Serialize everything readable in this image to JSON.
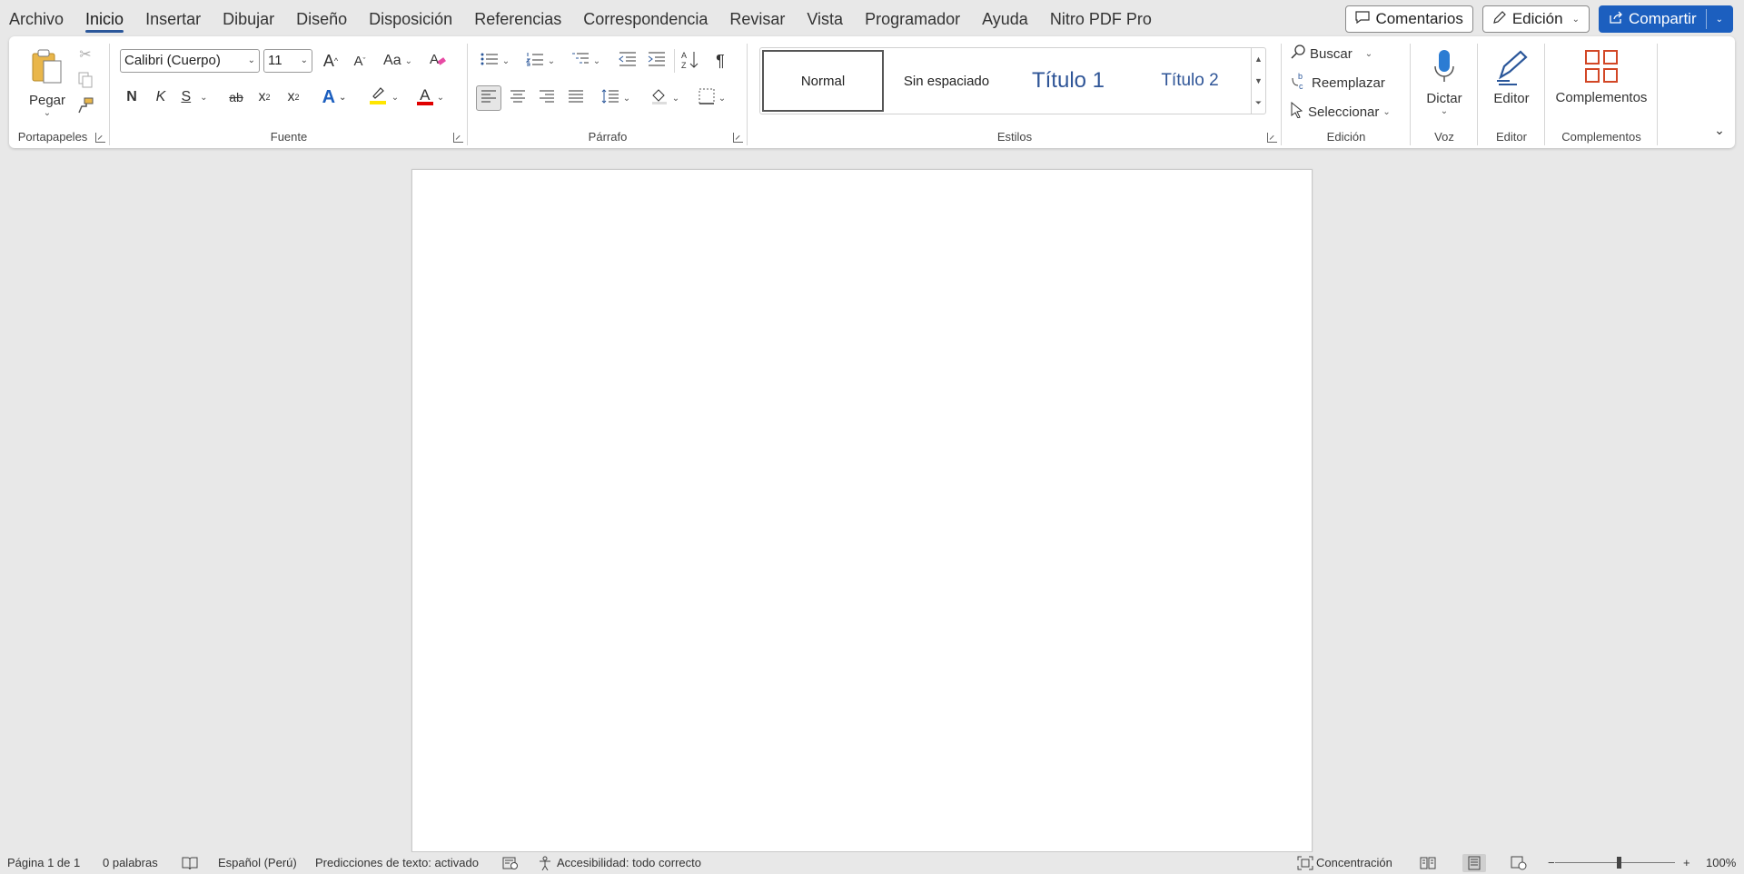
{
  "menu": {
    "tabs": [
      "Archivo",
      "Inicio",
      "Insertar",
      "Dibujar",
      "Diseño",
      "Disposición",
      "Referencias",
      "Correspondencia",
      "Revisar",
      "Vista",
      "Programador",
      "Ayuda",
      "Nitro PDF Pro"
    ],
    "active_tab": "Inicio"
  },
  "top_right": {
    "comments_label": "Comentarios",
    "editing_label": "Edición",
    "share_label": "Compartir"
  },
  "ribbon": {
    "clipboard": {
      "label": "Portapapeles",
      "paste_label": "Pegar"
    },
    "font": {
      "label": "Fuente",
      "font_name": "Calibri (Cuerpo)",
      "font_size": "11",
      "grow_label": "A",
      "shrink_label": "A",
      "case_label": "Aa",
      "bold_label": "N",
      "italic_label": "K",
      "underline_label": "S",
      "strike_label": "ab",
      "sub_label": "x",
      "sub_mark": "2",
      "sup_label": "x",
      "sup_mark": "2",
      "effects_label": "A",
      "font_color_label": "A",
      "highlight_color": "#ffe600",
      "font_color": "#e00000"
    },
    "paragraph": {
      "label": "Párrafo",
      "pilcrow": "¶"
    },
    "styles": {
      "label": "Estilos",
      "items": [
        "Normal",
        "Sin espaciado",
        "Título 1",
        "Título 2"
      ]
    },
    "editing": {
      "label": "Edición",
      "find_label": "Buscar",
      "replace_label": "Reemplazar",
      "select_label": "Seleccionar"
    },
    "voice": {
      "label": "Voz",
      "dictate_label": "Dictar"
    },
    "editor": {
      "label": "Editor",
      "editor_label": "Editor"
    },
    "addins": {
      "label": "Complementos",
      "addins_label": "Complementos"
    }
  },
  "status": {
    "page": "Página 1 de 1",
    "words": "0 palabras",
    "language": "Español (Perú)",
    "predictions": "Predicciones de texto: activado",
    "accessibility": "Accesibilidad: todo correcto",
    "focus": "Concentración",
    "zoom": "100%",
    "zoom_minus": "−",
    "zoom_plus": "+"
  },
  "colors": {
    "accent": "#2b579a",
    "share_bg": "#1c5fbf",
    "addins_icon": "#d24726"
  }
}
